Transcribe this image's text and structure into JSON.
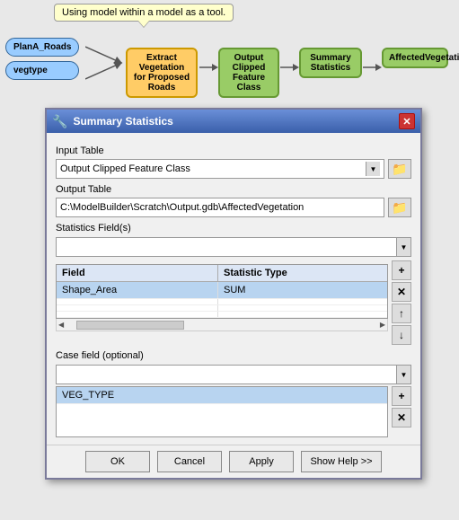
{
  "tooltip": {
    "text": "Using model within a model as a tool."
  },
  "diagram": {
    "nodes": [
      {
        "id": "planA",
        "label": "PlanA_Roads",
        "type": "oval"
      },
      {
        "id": "vegtype",
        "label": "vegtype",
        "type": "oval"
      },
      {
        "id": "extract",
        "label": "Extract Vegetation for Proposed Roads",
        "type": "yellow"
      },
      {
        "id": "outputClipped",
        "label": "Output Clipped Feature Class",
        "type": "green"
      },
      {
        "id": "summary",
        "label": "Summary Statistics",
        "type": "green"
      },
      {
        "id": "affected",
        "label": "AffectedVegetation",
        "type": "green"
      }
    ]
  },
  "dialog": {
    "title": "Summary Statistics",
    "close_label": "✕",
    "input_table_label": "Input Table",
    "input_table_value": "Output Clipped Feature Class",
    "output_table_label": "Output Table",
    "output_table_value": "C:\\ModelBuilder\\Scratch\\Output.gdb\\AffectedVegetation",
    "statistics_fields_label": "Statistics Field(s)",
    "table_headers": [
      "Field",
      "Statistic Type"
    ],
    "table_rows": [
      {
        "field": "Shape_Area",
        "stat": "SUM"
      },
      {
        "field": "",
        "stat": ""
      },
      {
        "field": "",
        "stat": ""
      },
      {
        "field": "",
        "stat": ""
      }
    ],
    "case_field_label": "Case field (optional)",
    "case_rows": [
      {
        "value": "VEG_TYPE"
      },
      {
        "value": ""
      },
      {
        "value": ""
      }
    ],
    "buttons": {
      "ok": "OK",
      "cancel": "Cancel",
      "apply": "Apply",
      "show_help": "Show Help >>"
    },
    "side_buttons": {
      "add": "+",
      "remove": "✕",
      "up": "↑",
      "down": "↓"
    }
  }
}
